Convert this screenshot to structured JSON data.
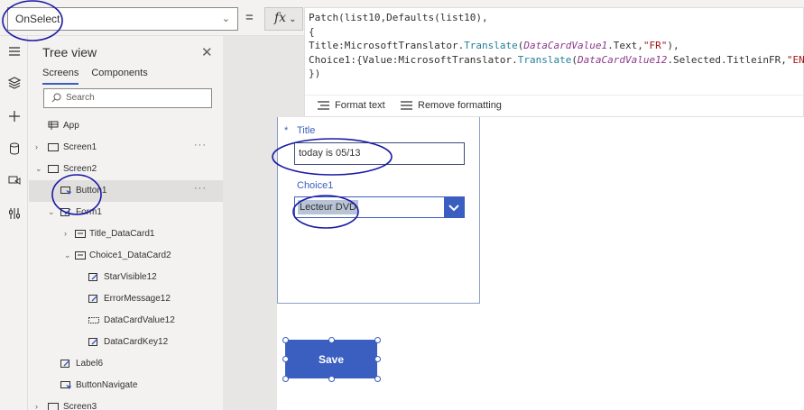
{
  "topbar": {
    "property": "OnSelect",
    "equals": "=",
    "fx": "fx"
  },
  "formula": {
    "lines": [
      {
        "pre": "Patch(list10,Defaults(list10),",
        "parts": []
      },
      {
        "pre": "{",
        "parts": []
      }
    ],
    "line1": "Patch(list10,Defaults(list10),",
    "line2": "{",
    "line3_a": "Title:MicrosoftTranslator.",
    "line3_b": "Translate",
    "line3_c": "(",
    "line3_d": "DataCardValue1",
    "line3_e": ".Text,",
    "line3_f": "\"FR\"",
    "line3_g": "),",
    "line4_a": "Choice1:{Value:MicrosoftTranslator.",
    "line4_b": "Translate",
    "line4_c": "(",
    "line4_d": "DataCardValue12",
    "line4_e": ".Selected.TitleinFR,",
    "line4_f": "\"EN\"",
    "line4_g": ")}",
    "line5": "})",
    "format_text": "Format text",
    "remove_formatting": "Remove formatting"
  },
  "tree": {
    "title": "Tree view",
    "tabs": [
      "Screens",
      "Components"
    ],
    "search_placeholder": "Search",
    "items": [
      {
        "label": "App",
        "icon": "app-icon"
      },
      {
        "label": "Screen1",
        "icon": "screen-icon"
      },
      {
        "label": "Screen2",
        "icon": "screen-icon"
      },
      {
        "label": "Button1",
        "icon": "button-icon"
      },
      {
        "label": "Form1",
        "icon": "form-icon"
      },
      {
        "label": "Title_DataCard1",
        "icon": "card-icon"
      },
      {
        "label": "Choice1_DataCard2",
        "icon": "card-icon"
      },
      {
        "label": "StarVisible12",
        "icon": "label-icon"
      },
      {
        "label": "ErrorMessage12",
        "icon": "label-icon"
      },
      {
        "label": "DataCardValue12",
        "icon": "dropdown-icon"
      },
      {
        "label": "DataCardKey12",
        "icon": "label-icon"
      },
      {
        "label": "Label6",
        "icon": "label-icon"
      },
      {
        "label": "ButtonNavigate",
        "icon": "button-icon"
      },
      {
        "label": "Screen3",
        "icon": "screen-icon"
      }
    ],
    "more": "···"
  },
  "form": {
    "required_mark": "*",
    "title_label": "Title",
    "title_value": "today is 05/13",
    "choice_label": "Choice1",
    "choice_value": "Lecteur DVD"
  },
  "save_button": "Save",
  "colors": {
    "accent": "#3b5fc0",
    "annotation": "#1a1aa6"
  }
}
